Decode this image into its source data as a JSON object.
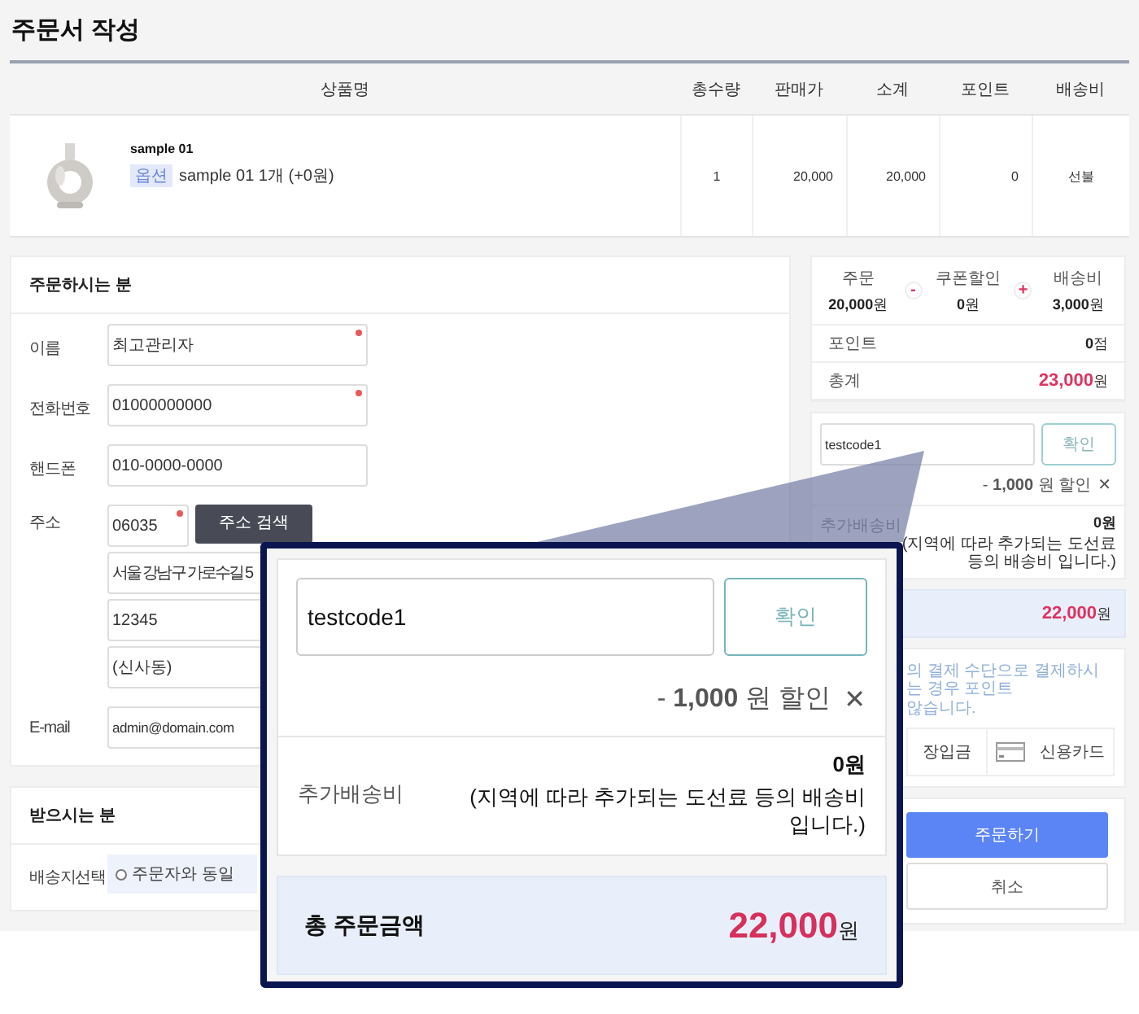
{
  "page_title": "주문서 작성",
  "product_table": {
    "columns": [
      "상품명",
      "총수량",
      "판매가",
      "소계",
      "포인트",
      "배송비"
    ],
    "rows": [
      {
        "cells": [
          {
            "kind": "product",
            "name": "sample 01",
            "option_tag": "옵션",
            "option": "sample 01 1개 (+0원)"
          },
          "1",
          "20,000",
          "20,000",
          "0",
          "선불"
        ]
      }
    ]
  },
  "orderer": {
    "title": "주문하시는 분",
    "fields": [
      {
        "kind": "text",
        "label": "이름",
        "value": "최고관리자",
        "required": true
      },
      {
        "kind": "text",
        "label": "전화번호",
        "value": "01000000000",
        "required": true
      },
      {
        "kind": "text",
        "label": "핸드폰",
        "value": "010-0000-0000",
        "required": false
      },
      {
        "kind": "address",
        "label": "주소",
        "zip": "06035",
        "required": true,
        "search_button": "주소 검색",
        "lines": [
          "서울 강남구 가로수길 5",
          "12345",
          "(신사동)"
        ]
      },
      {
        "kind": "text",
        "label": "E-mail",
        "value": "admin@domain.com",
        "required": false
      }
    ]
  },
  "recipient": {
    "title": "받으시는 분",
    "fields": [
      {
        "kind": "radio",
        "label": "배송지선택",
        "options": [
          {
            "label": "주문자와 동일",
            "selected": false
          }
        ]
      }
    ]
  },
  "summary": {
    "items": [
      {
        "label": "주문",
        "value": "20,000",
        "unit": "원"
      },
      {
        "label": "쿠폰할인",
        "value": "0",
        "unit": "원"
      },
      {
        "label": "배송비",
        "value": "3,000",
        "unit": "원"
      }
    ],
    "operators": [
      "-",
      "+"
    ],
    "rows": [
      {
        "label": "포인트",
        "value": "0",
        "unit": "점",
        "highlight": false
      },
      {
        "label": "총계",
        "value": "23,000",
        "unit": "원",
        "highlight": true
      }
    ]
  },
  "coupon": {
    "code": "testcode1",
    "button": "확인",
    "discount": "- **1,000** 원 할인",
    "remove": "✕",
    "extra_label": "추가배송비",
    "extra_amount": "0원",
    "extra_note": "(지역에 따라 추가되는 도선료 등의 배송비 입니다.)"
  },
  "grand_total": {
    "value": "22,000",
    "unit": "원"
  },
  "payment": {
    "notice_lines": [
      "의 결제 수단으로 결제하시는 경우 포인트",
      "않습니다."
    ],
    "methods": [
      {
        "kind": "plain",
        "label": "장입금"
      },
      {
        "kind": "card",
        "label": "신용카드"
      }
    ]
  },
  "actions": [
    {
      "kind": "primary",
      "label": "주문하기"
    },
    {
      "kind": "secondary",
      "label": "취소"
    }
  ],
  "magnifier": {
    "code": "testcode1",
    "button": "확인",
    "discount": "- **1,000** 원 할인",
    "remove": "✕",
    "extra_label": "추가배송비",
    "extra_amount": "0원",
    "extra_note": "(지역에 따라 추가되는 도선료 등의 배송비 입니다.)",
    "total_label": "총 주문금액",
    "total_value": "22,000",
    "total_unit": "원"
  }
}
